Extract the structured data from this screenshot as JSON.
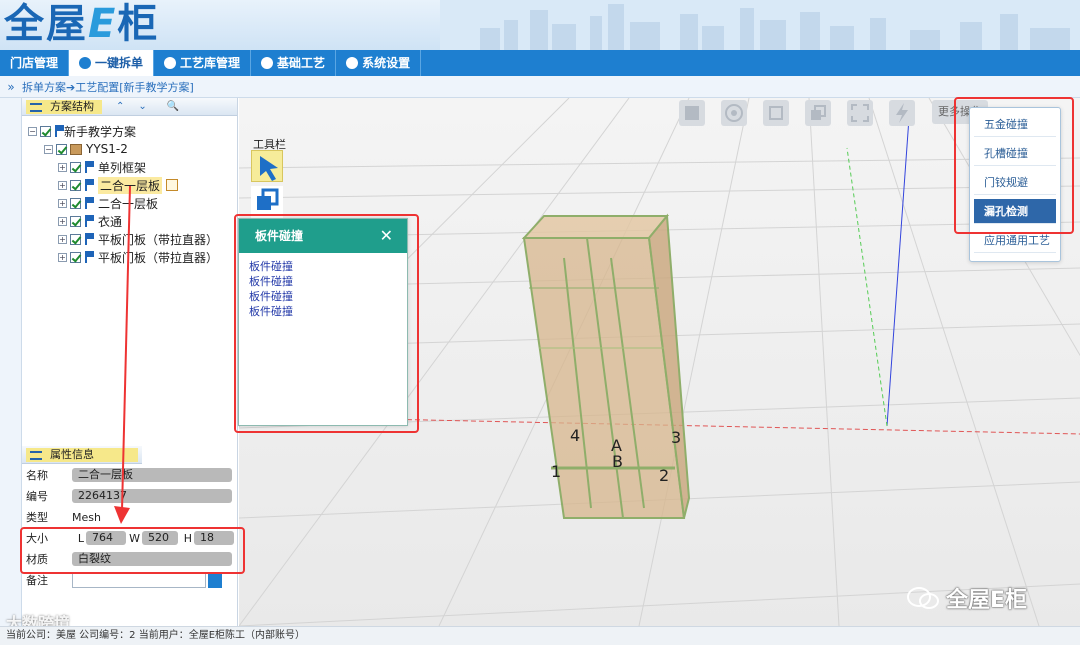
{
  "header": {
    "logo_text": "全屋",
    "logo_e": "E",
    "logo_suffix": "柜"
  },
  "nav": [
    {
      "label": "门店管理",
      "active": false
    },
    {
      "label": "一键拆单",
      "active": true
    },
    {
      "label": "工艺库管理",
      "active": false
    },
    {
      "label": "基础工艺",
      "active": false
    },
    {
      "label": "系统设置",
      "active": false
    }
  ],
  "breadcrumb": {
    "arrows": "»",
    "text": "拆单方案➔工艺配置[新手教学方案]"
  },
  "tree_panel": {
    "title": "方案结构",
    "expand_icon": "⌃",
    "collapse_icon": "⌄",
    "search_icon": "🔍",
    "items": [
      {
        "label": "新手教学方案",
        "level": 0
      },
      {
        "label": "YYS1-2",
        "level": 1
      },
      {
        "label": "单列框架",
        "level": 2
      },
      {
        "label": "二合一层板",
        "level": 2,
        "selected": true
      },
      {
        "label": "二合一层板",
        "level": 2
      },
      {
        "label": "衣通",
        "level": 2
      },
      {
        "label": "平板门板（带拉直器）",
        "level": 2
      },
      {
        "label": "平板门板（带拉直器）",
        "level": 2
      }
    ]
  },
  "props_panel": {
    "title": "属性信息",
    "name_key": "名称",
    "name_val": "二合一层板",
    "code_key": "编号",
    "code_val": "2264137",
    "type_key": "类型",
    "type_val": "Mesh",
    "size_key": "大小",
    "L_label": "L",
    "L_val": "764",
    "W_label": "W",
    "W_val": "520",
    "H_label": "H",
    "H_val": "18",
    "material_key": "材质",
    "material_val": "白裂纹",
    "note_key": "备注",
    "note_val": ""
  },
  "viewport": {
    "toolbox_label": "工具栏",
    "more_label": "更多操作",
    "markers": [
      "4",
      "A",
      "B",
      "3",
      "1",
      "2"
    ]
  },
  "popup": {
    "title": "板件碰撞",
    "close": "✕",
    "items": [
      "板件碰撞",
      "板件碰撞",
      "板件碰撞",
      "板件碰撞"
    ]
  },
  "right_menu": [
    {
      "label": "五金碰撞",
      "active": false
    },
    {
      "label": "孔槽碰撞",
      "active": false
    },
    {
      "label": "门铰规避",
      "active": false
    },
    {
      "label": "漏孔检测",
      "active": true
    },
    {
      "label": "应用通用工艺",
      "active": false
    }
  ],
  "status": {
    "text": "当前公司：美屋   公司编号：2    当前用户：全屋E柜陈工（内部账号）"
  },
  "watermark": {
    "right": "全屋E柜",
    "left": "大数跨境"
  },
  "colors": {
    "nav": "#1e7fd0",
    "popup_head": "#1f9e8c",
    "highlight": "#ee3333",
    "menu_active": "#2e67a9"
  }
}
